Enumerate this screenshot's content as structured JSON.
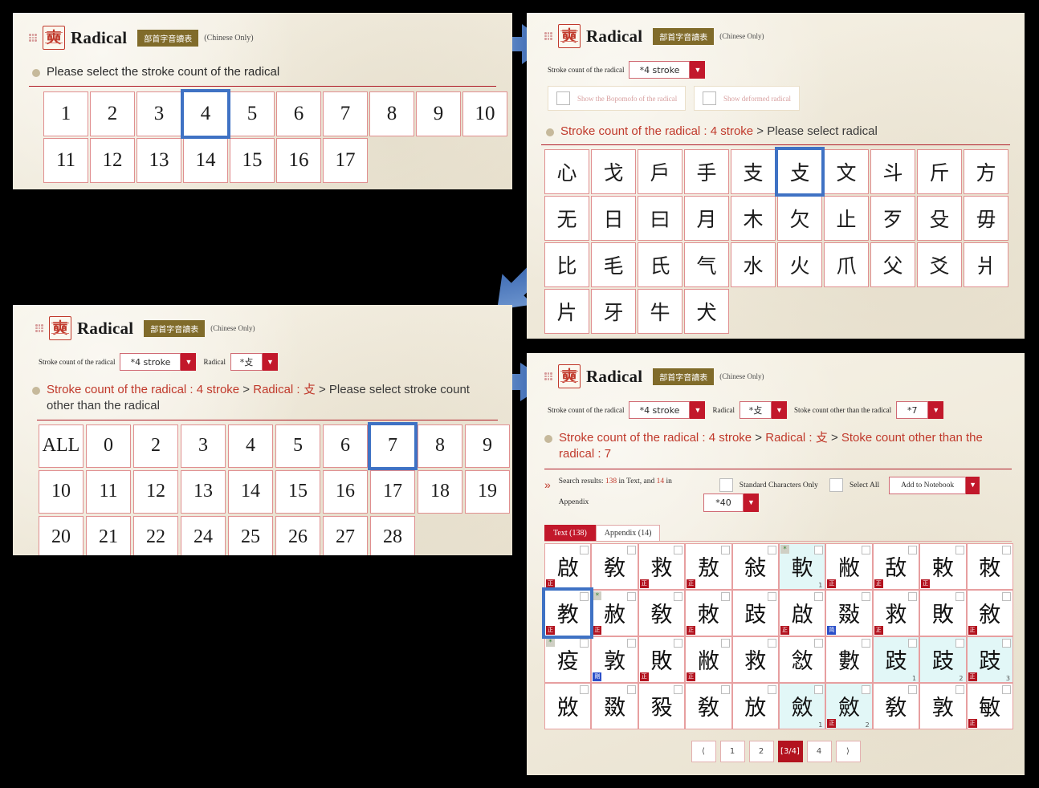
{
  "header": {
    "title": "Radical",
    "badge": "部首字音讀表",
    "note": "(Chinese Only)",
    "logo_glyph": "奭",
    "grip_icon": "grip-dots-icon"
  },
  "panel_a": {
    "prompt_plain": "Please select the stroke count of the radical",
    "stroke_counts": [
      "1",
      "2",
      "3",
      "4",
      "5",
      "6",
      "7",
      "8",
      "9",
      "10",
      "11",
      "12",
      "13",
      "14",
      "15",
      "16",
      "17"
    ],
    "selected": "4"
  },
  "panel_b": {
    "filters": [
      {
        "label": "Stroke count of the radical",
        "value": "*4 stroke"
      }
    ],
    "checkboxes": [
      {
        "label": "Show the Bopomofo of the radical",
        "checked": false
      },
      {
        "label": "Show deformed radical",
        "checked": false
      }
    ],
    "breadcrumb": {
      "part1": "Stroke count of the radical : 4 stroke",
      "sep1": ">",
      "part2": "Please select radical"
    },
    "radicals": [
      "心",
      "戈",
      "戶",
      "手",
      "支",
      "攴",
      "文",
      "斗",
      "斤",
      "方",
      "无",
      "日",
      "曰",
      "月",
      "木",
      "欠",
      "止",
      "歹",
      "殳",
      "毋",
      "比",
      "毛",
      "氏",
      "气",
      "水",
      "火",
      "爪",
      "父",
      "爻",
      "爿",
      "片",
      "牙",
      "牛",
      "犬"
    ],
    "selected": "攴"
  },
  "panel_c": {
    "filters": [
      {
        "label": "Stroke count of the radical",
        "value": "*4 stroke"
      },
      {
        "label": "Radical",
        "value": "*攴"
      }
    ],
    "breadcrumb": {
      "part1": "Stroke count of the radical : 4 stroke",
      "sep1": ">",
      "part2": "Radical : 攴",
      "sep2": ">",
      "part3": "Please select stroke count other than the radical"
    },
    "counts": [
      "ALL",
      "0",
      "2",
      "3",
      "4",
      "5",
      "6",
      "7",
      "8",
      "9",
      "10",
      "11",
      "12",
      "13",
      "14",
      "15",
      "16",
      "17",
      "18",
      "19",
      "20",
      "21",
      "22",
      "24",
      "25",
      "26",
      "27",
      "28"
    ],
    "selected": "7"
  },
  "panel_d": {
    "filters": [
      {
        "label": "Stroke count of the radical",
        "value": "*4 stroke"
      },
      {
        "label": "Radical",
        "value": "*攴"
      },
      {
        "label": "Stoke count other than the radical",
        "value": "*7"
      }
    ],
    "breadcrumb": {
      "part1": "Stroke count of the radical : 4 stroke",
      "sep1": ">",
      "part2": "Radical : 攴",
      "sep2": ">",
      "part3": "Stoke count other than the radical : 7"
    },
    "results": {
      "prefix": "Search results:",
      "text_count": "138",
      "mid": "in Text, and",
      "appendix_count": "14",
      "suffix": "in",
      "suffix2": "Appendix",
      "standard_only_label": "Standard Characters Only",
      "select_all_label": "Select All",
      "notebook_label": "Add to Notebook",
      "per_page_value": "*40"
    },
    "tabs": [
      {
        "label": "Text (138)",
        "active": true
      },
      {
        "label": "Appendix (14)",
        "active": false
      }
    ],
    "characters": [
      {
        "ch": "啟",
        "tag": "正",
        "tagColor": "red"
      },
      {
        "ch": "敎"
      },
      {
        "ch": "救",
        "tag": "正",
        "tagColor": "red"
      },
      {
        "ch": "敖",
        "tag": "正",
        "tagColor": "red"
      },
      {
        "ch": "敍"
      },
      {
        "ch": "軟",
        "tint": true,
        "star": true,
        "idx": "1"
      },
      {
        "ch": "敝",
        "tag": "正",
        "tagColor": "red"
      },
      {
        "ch": "敌",
        "tag": "正",
        "tagColor": "red"
      },
      {
        "ch": "敕",
        "tag": "正",
        "tagColor": "red"
      },
      {
        "ch": "敇"
      },
      {
        "ch": "教",
        "tag": "正",
        "tagColor": "red",
        "selected": true
      },
      {
        "ch": "赦",
        "tag": "正",
        "tagColor": "red",
        "star": true
      },
      {
        "ch": "敎"
      },
      {
        "ch": "敇",
        "tag": "正",
        "tagColor": "red"
      },
      {
        "ch": "跂"
      },
      {
        "ch": "啟",
        "tag": "正",
        "tagColor": "red"
      },
      {
        "ch": "敠",
        "tag": "简",
        "tagColor": "blue"
      },
      {
        "ch": "救",
        "tag": "正",
        "tagColor": "red"
      },
      {
        "ch": "敗"
      },
      {
        "ch": "敘",
        "tag": "正",
        "tagColor": "red"
      },
      {
        "ch": "疫",
        "star": true
      },
      {
        "ch": "敦",
        "tag": "剛",
        "tagColor": "blue"
      },
      {
        "ch": "敗",
        "tag": "正",
        "tagColor": "red"
      },
      {
        "ch": "敝",
        "tag": "正",
        "tagColor": "red"
      },
      {
        "ch": "救"
      },
      {
        "ch": "敜"
      },
      {
        "ch": "數"
      },
      {
        "ch": "跂",
        "tint": true,
        "idx": "1"
      },
      {
        "ch": "跂",
        "tint": true,
        "idx": "2"
      },
      {
        "ch": "跂",
        "tint": true,
        "tag": "正",
        "tagColor": "red",
        "idx": "3"
      },
      {
        "ch": "敚"
      },
      {
        "ch": "敪"
      },
      {
        "ch": "豛"
      },
      {
        "ch": "敎"
      },
      {
        "ch": "放"
      },
      {
        "ch": "斂",
        "tint": true,
        "idx": "1"
      },
      {
        "ch": "斂",
        "tint": true,
        "tag": "正",
        "tagColor": "red",
        "idx": "2"
      },
      {
        "ch": "敎"
      },
      {
        "ch": "敦"
      },
      {
        "ch": "敏",
        "tag": "正",
        "tagColor": "red"
      }
    ],
    "pagination": {
      "prev": "⟨",
      "pages": [
        "1",
        "2",
        "[3/4]",
        "4"
      ],
      "next": "⟩",
      "active": "[3/4]"
    }
  }
}
